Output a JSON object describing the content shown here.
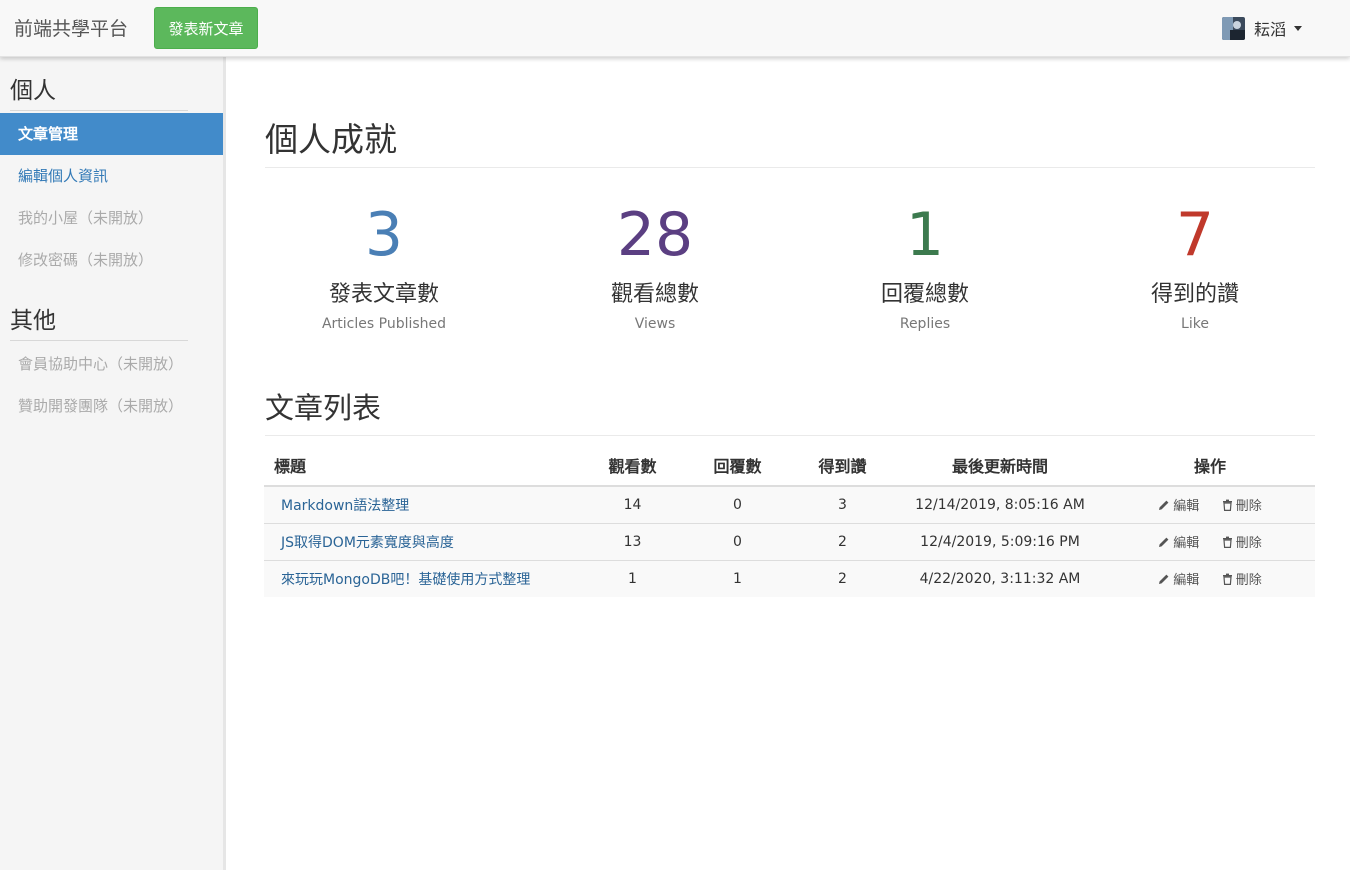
{
  "navbar": {
    "brand": "前端共學平台",
    "new_post_label": "發表新文章",
    "user_name": "耘滔"
  },
  "sidebar": {
    "personal_heading": "個人",
    "personal_items": [
      {
        "label": "文章管理",
        "state": "active"
      },
      {
        "label": "編輯個人資訊",
        "state": "link"
      },
      {
        "label": "我的小屋（未開放）",
        "state": "disabled"
      },
      {
        "label": "修改密碼（未開放）",
        "state": "disabled"
      }
    ],
    "other_heading": "其他",
    "other_items": [
      {
        "label": "會員協助中心（未開放）",
        "state": "disabled"
      },
      {
        "label": "贊助開發團隊（未開放）",
        "state": "disabled"
      }
    ]
  },
  "achievements": {
    "title": "個人成就",
    "stats": [
      {
        "value": "3",
        "label": "發表文章數",
        "sub": "Articles Published",
        "color": "#4a7fb5"
      },
      {
        "value": "28",
        "label": "觀看總數",
        "sub": "Views",
        "color": "#5b3f82"
      },
      {
        "value": "1",
        "label": "回覆總數",
        "sub": "Replies",
        "color": "#3c7a4e"
      },
      {
        "value": "7",
        "label": "得到的讚",
        "sub": "Like",
        "color": "#c0392b"
      }
    ]
  },
  "articles": {
    "title": "文章列表",
    "columns": [
      "標題",
      "觀看數",
      "回覆數",
      "得到讚",
      "最後更新時間",
      "操作"
    ],
    "edit_label": "編輯",
    "delete_label": "刪除",
    "rows": [
      {
        "title": "Markdown語法整理",
        "views": "14",
        "replies": "0",
        "likes": "3",
        "updated": "12/14/2019, 8:05:16 AM"
      },
      {
        "title": "JS取得DOM元素寬度與高度",
        "views": "13",
        "replies": "0",
        "likes": "2",
        "updated": "12/4/2019, 5:09:16 PM"
      },
      {
        "title": "來玩玩MongoDB吧！基礎使用方式整理",
        "views": "1",
        "replies": "1",
        "likes": "2",
        "updated": "4/22/2020, 3:11:32 AM"
      }
    ]
  }
}
